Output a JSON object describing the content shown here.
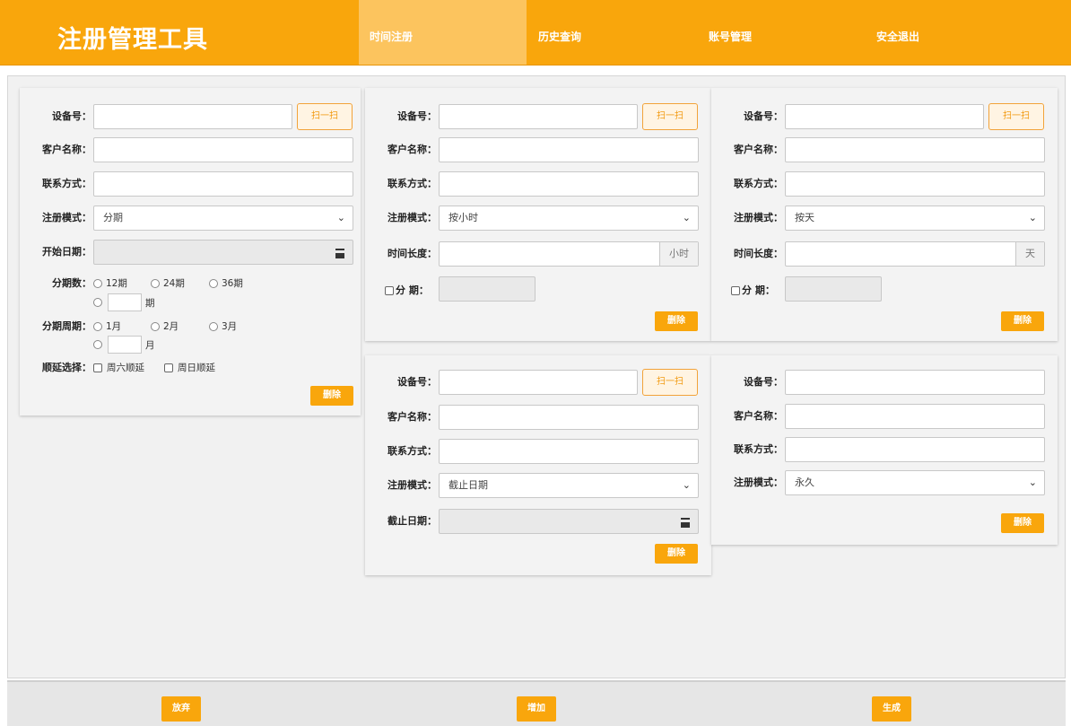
{
  "app": {
    "title": "注册管理工具"
  },
  "nav": [
    {
      "label": "时间注册",
      "active": true
    },
    {
      "label": "历史查询"
    },
    {
      "label": "账号管理"
    },
    {
      "label": "安全退出"
    }
  ],
  "common": {
    "device_label": "设备号：",
    "customer_label": "客户名称：",
    "contact_label": "联系方式：",
    "mode_label": "注册模式：",
    "scan_label": "扫一扫",
    "delete_label": "删除"
  },
  "card1": {
    "mode_value": "分期",
    "start_date_label": "开始日期：",
    "installments_label": "分期数：",
    "installment_options": [
      "12期",
      "24期",
      "36期"
    ],
    "installment_custom_unit": "期",
    "cycle_label": "分期周期：",
    "cycle_options": [
      "1月",
      "2月",
      "3月"
    ],
    "cycle_custom_unit": "月",
    "defer_label": "顺延选择：",
    "defer_options": [
      "周六顺延",
      "周日顺延"
    ]
  },
  "card2": {
    "mode_value": "按小时",
    "duration_label": "时间长度：",
    "duration_unit": "小时",
    "installment_check_label": "分 期："
  },
  "card3": {
    "mode_value": "按天",
    "duration_label": "时间长度：",
    "duration_unit": "天",
    "installment_check_label": "分 期："
  },
  "card4": {
    "mode_value": "截止日期",
    "end_date_label": "截止日期："
  },
  "card5": {
    "mode_value": "永久"
  },
  "footer": {
    "discard_label": "放弃",
    "add_label": "增加",
    "generate_label": "生成"
  },
  "colors": {
    "accent": "#f9a60c",
    "nav_active": "#fcc45e"
  },
  "icons": [
    "calendar-icon",
    "chevron-down-icon"
  ]
}
